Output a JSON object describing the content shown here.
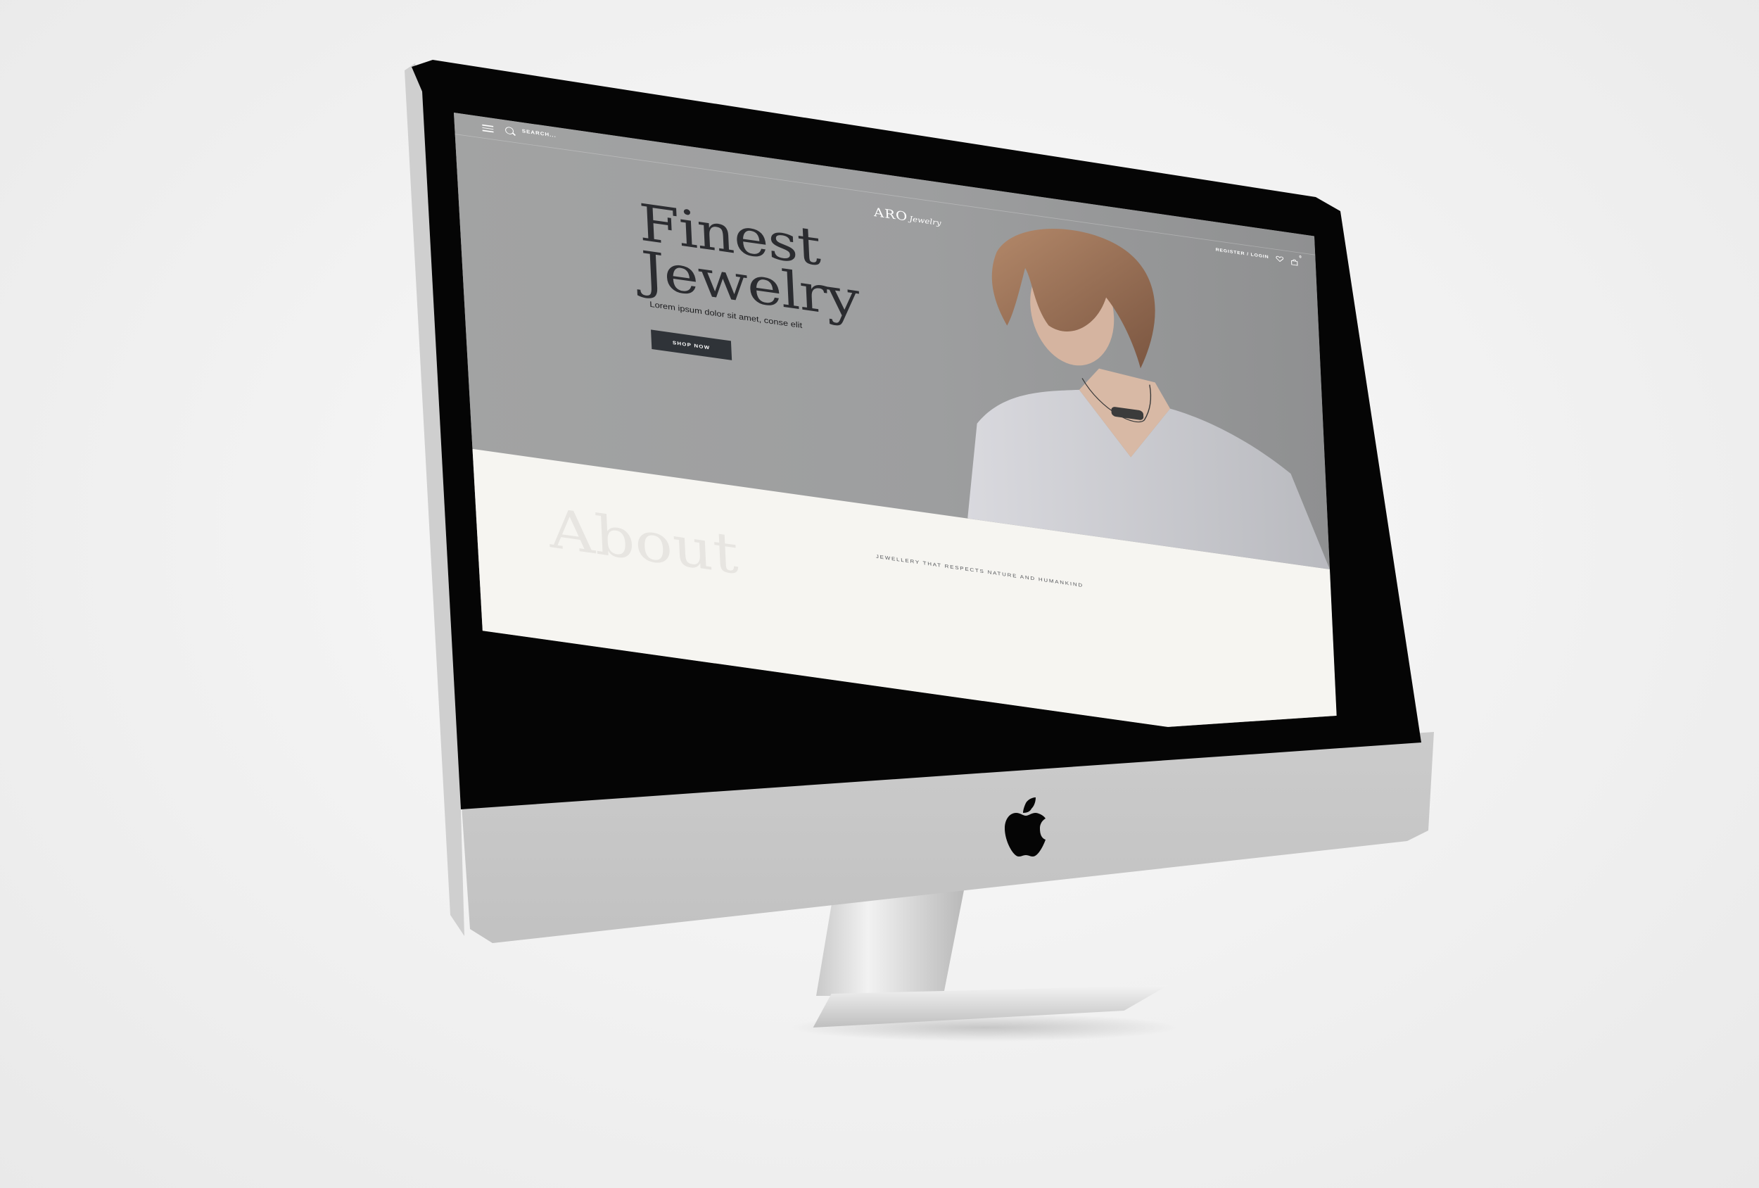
{
  "site": {
    "brand": {
      "name": "ARO",
      "script": "Jewelry"
    },
    "search": {
      "placeholder": "SEARCH..."
    },
    "account": {
      "register_login": "REGISTER / LOGIN",
      "cart_count": "0"
    },
    "hero": {
      "headline_line1": "Finest",
      "headline_line2": "Jewelry",
      "subtext": "Lorem ipsum dolor sit amet, conse elit",
      "cta": "SHOP NOW"
    },
    "about": {
      "ghost_title": "About",
      "tagline": "JEWELLERY THAT RESPECTS NATURE AND HUMANKIND"
    }
  },
  "colors": {
    "hero_bg": "#9d9e9f",
    "headline": "#2b2c30",
    "button": "#2f3338",
    "about_bg": "#f6f5f1"
  },
  "icons": [
    "menu-icon",
    "search-icon",
    "heart-icon",
    "bag-icon",
    "apple-logo-icon"
  ]
}
